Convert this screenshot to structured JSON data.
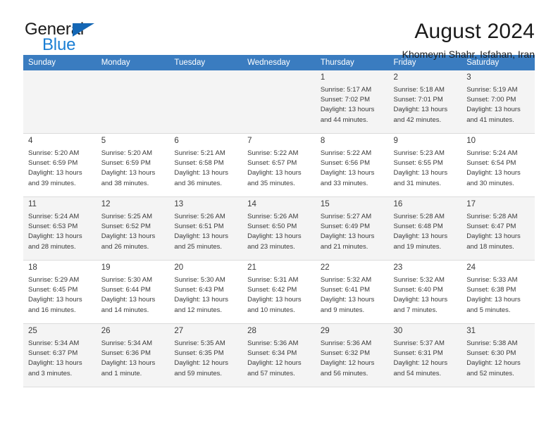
{
  "brand": {
    "name_top": "General",
    "name_bottom": "Blue"
  },
  "header": {
    "title": "August 2024",
    "subtitle": "Khomeyni Shahr, Isfahan, Iran",
    "accent_color": "#3a7cc0",
    "brand_blue": "#1b7fd4"
  },
  "weekday_headers": [
    "Sunday",
    "Monday",
    "Tuesday",
    "Wednesday",
    "Thursday",
    "Friday",
    "Saturday"
  ],
  "weeks": [
    [
      {
        "day": "",
        "info": ""
      },
      {
        "day": "",
        "info": ""
      },
      {
        "day": "",
        "info": ""
      },
      {
        "day": "",
        "info": ""
      },
      {
        "day": "1",
        "info": "Sunrise: 5:17 AM\nSunset: 7:02 PM\nDaylight: 13 hours\nand 44 minutes."
      },
      {
        "day": "2",
        "info": "Sunrise: 5:18 AM\nSunset: 7:01 PM\nDaylight: 13 hours\nand 42 minutes."
      },
      {
        "day": "3",
        "info": "Sunrise: 5:19 AM\nSunset: 7:00 PM\nDaylight: 13 hours\nand 41 minutes."
      }
    ],
    [
      {
        "day": "4",
        "info": "Sunrise: 5:20 AM\nSunset: 6:59 PM\nDaylight: 13 hours\nand 39 minutes."
      },
      {
        "day": "5",
        "info": "Sunrise: 5:20 AM\nSunset: 6:59 PM\nDaylight: 13 hours\nand 38 minutes."
      },
      {
        "day": "6",
        "info": "Sunrise: 5:21 AM\nSunset: 6:58 PM\nDaylight: 13 hours\nand 36 minutes."
      },
      {
        "day": "7",
        "info": "Sunrise: 5:22 AM\nSunset: 6:57 PM\nDaylight: 13 hours\nand 35 minutes."
      },
      {
        "day": "8",
        "info": "Sunrise: 5:22 AM\nSunset: 6:56 PM\nDaylight: 13 hours\nand 33 minutes."
      },
      {
        "day": "9",
        "info": "Sunrise: 5:23 AM\nSunset: 6:55 PM\nDaylight: 13 hours\nand 31 minutes."
      },
      {
        "day": "10",
        "info": "Sunrise: 5:24 AM\nSunset: 6:54 PM\nDaylight: 13 hours\nand 30 minutes."
      }
    ],
    [
      {
        "day": "11",
        "info": "Sunrise: 5:24 AM\nSunset: 6:53 PM\nDaylight: 13 hours\nand 28 minutes."
      },
      {
        "day": "12",
        "info": "Sunrise: 5:25 AM\nSunset: 6:52 PM\nDaylight: 13 hours\nand 26 minutes."
      },
      {
        "day": "13",
        "info": "Sunrise: 5:26 AM\nSunset: 6:51 PM\nDaylight: 13 hours\nand 25 minutes."
      },
      {
        "day": "14",
        "info": "Sunrise: 5:26 AM\nSunset: 6:50 PM\nDaylight: 13 hours\nand 23 minutes."
      },
      {
        "day": "15",
        "info": "Sunrise: 5:27 AM\nSunset: 6:49 PM\nDaylight: 13 hours\nand 21 minutes."
      },
      {
        "day": "16",
        "info": "Sunrise: 5:28 AM\nSunset: 6:48 PM\nDaylight: 13 hours\nand 19 minutes."
      },
      {
        "day": "17",
        "info": "Sunrise: 5:28 AM\nSunset: 6:47 PM\nDaylight: 13 hours\nand 18 minutes."
      }
    ],
    [
      {
        "day": "18",
        "info": "Sunrise: 5:29 AM\nSunset: 6:45 PM\nDaylight: 13 hours\nand 16 minutes."
      },
      {
        "day": "19",
        "info": "Sunrise: 5:30 AM\nSunset: 6:44 PM\nDaylight: 13 hours\nand 14 minutes."
      },
      {
        "day": "20",
        "info": "Sunrise: 5:30 AM\nSunset: 6:43 PM\nDaylight: 13 hours\nand 12 minutes."
      },
      {
        "day": "21",
        "info": "Sunrise: 5:31 AM\nSunset: 6:42 PM\nDaylight: 13 hours\nand 10 minutes."
      },
      {
        "day": "22",
        "info": "Sunrise: 5:32 AM\nSunset: 6:41 PM\nDaylight: 13 hours\nand 9 minutes."
      },
      {
        "day": "23",
        "info": "Sunrise: 5:32 AM\nSunset: 6:40 PM\nDaylight: 13 hours\nand 7 minutes."
      },
      {
        "day": "24",
        "info": "Sunrise: 5:33 AM\nSunset: 6:38 PM\nDaylight: 13 hours\nand 5 minutes."
      }
    ],
    [
      {
        "day": "25",
        "info": "Sunrise: 5:34 AM\nSunset: 6:37 PM\nDaylight: 13 hours\nand 3 minutes."
      },
      {
        "day": "26",
        "info": "Sunrise: 5:34 AM\nSunset: 6:36 PM\nDaylight: 13 hours\nand 1 minute."
      },
      {
        "day": "27",
        "info": "Sunrise: 5:35 AM\nSunset: 6:35 PM\nDaylight: 12 hours\nand 59 minutes."
      },
      {
        "day": "28",
        "info": "Sunrise: 5:36 AM\nSunset: 6:34 PM\nDaylight: 12 hours\nand 57 minutes."
      },
      {
        "day": "29",
        "info": "Sunrise: 5:36 AM\nSunset: 6:32 PM\nDaylight: 12 hours\nand 56 minutes."
      },
      {
        "day": "30",
        "info": "Sunrise: 5:37 AM\nSunset: 6:31 PM\nDaylight: 12 hours\nand 54 minutes."
      },
      {
        "day": "31",
        "info": "Sunrise: 5:38 AM\nSunset: 6:30 PM\nDaylight: 12 hours\nand 52 minutes."
      }
    ]
  ]
}
